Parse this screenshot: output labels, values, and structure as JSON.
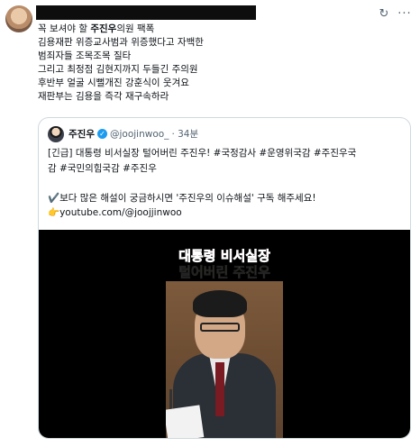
{
  "post": {
    "lines": [
      {
        "pre": "꼭 보셔야 할 ",
        "bold": "주진우",
        "post": "의원 팩폭"
      },
      {
        "pre": "김용재판 위증교사범과 위증했다고 자백한",
        "bold": "",
        "post": ""
      },
      {
        "pre": "범죄자들 조목조목 질타",
        "bold": "",
        "post": ""
      },
      {
        "pre": "그리고 최정점 김현지까지 두들긴 주의원",
        "bold": "",
        "post": ""
      },
      {
        "pre": "후반부 얼굴 시뻘개진 강훈식이 웃겨요",
        "bold": "",
        "post": ""
      },
      {
        "pre": "재판부는 김용을 즉각 재구속하라",
        "bold": "",
        "post": ""
      }
    ],
    "icons": {
      "refresh": "refresh-icon",
      "more": "more-icon"
    }
  },
  "quote": {
    "name": "주진우",
    "handle": "@joojinwoo_",
    "time": "· 34분",
    "lines": [
      "[긴급] 대통령 비서실장 털어버린 주진우! #국정감사 #운영위국감 #주진우국",
      "감 #국민의힘국감 #주진우",
      "",
      "✔️보다 많은 해설이 궁금하시면 '주진우의 이슈해설' 구독 해주세요!",
      "👉youtube.com/@joojjinwoo"
    ],
    "video_caption": [
      "대통령 비서실장",
      "털어버린 주진우"
    ]
  }
}
